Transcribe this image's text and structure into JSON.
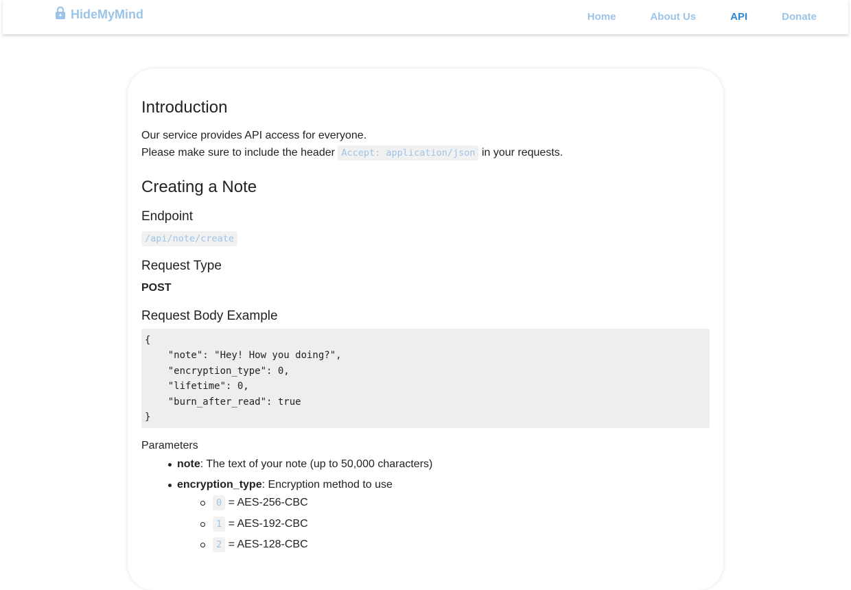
{
  "nav": {
    "brand": "HideMyMind",
    "links": [
      {
        "label": "Home",
        "active": false
      },
      {
        "label": "About Us",
        "active": false
      },
      {
        "label": "API",
        "active": true
      },
      {
        "label": "Donate",
        "active": false
      }
    ]
  },
  "intro": {
    "title": "Introduction",
    "line1": "Our service provides API access for everyone.",
    "line2_prefix": "Please make sure to include the header",
    "line2_code": "Accept: application/json",
    "line2_suffix": "in your requests."
  },
  "create_note": {
    "title": "Creating a Note",
    "endpoint_label": "Endpoint",
    "endpoint_value": "/api/note/create",
    "request_type_label": "Request Type",
    "request_type_value": "POST",
    "body_label": "Request Body Example",
    "body_code": "{\n    \"note\": \"Hey! How you doing?\",\n    \"encryption_type\": 0,\n    \"lifetime\": 0,\n    \"burn_after_read\": true\n}",
    "params_label": "Parameters",
    "params": [
      {
        "name": "note",
        "desc": ": The text of your note (up to 50,000 characters)"
      },
      {
        "name": "encryption_type",
        "desc": ": Encryption method to use"
      }
    ],
    "encryption_options": [
      {
        "code": "0",
        "label": "= AES-256-CBC"
      },
      {
        "code": "1",
        "label": "= AES-192-CBC"
      },
      {
        "code": "2",
        "label": "= AES-128-CBC"
      }
    ]
  },
  "colors": {
    "link": "#9cc4e8",
    "link_active": "#2f86cf"
  }
}
